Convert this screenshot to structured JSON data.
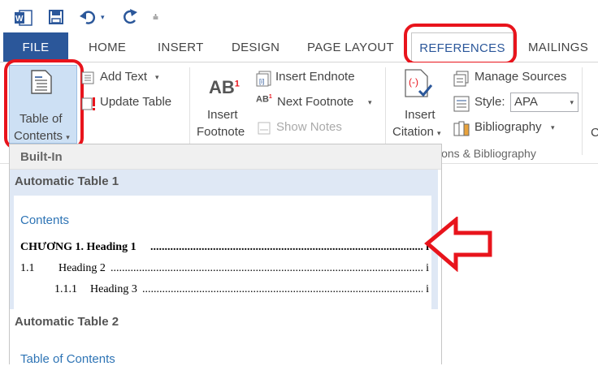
{
  "qat": {
    "word_icon": "word-logo-icon",
    "save_icon": "save-icon",
    "undo_icon": "undo-icon",
    "redo_icon": "redo-icon",
    "customize_icon": "customize-qat-icon"
  },
  "tabs": {
    "file": "FILE",
    "home": "HOME",
    "insert": "INSERT",
    "design": "DESIGN",
    "page_layout": "PAGE LAYOUT",
    "references": "REFERENCES",
    "mailings": "MAILINGS"
  },
  "ribbon": {
    "toc_line1": "Table of",
    "toc_line2": "Contents",
    "add_text": "Add Text",
    "update_table": "Update Table",
    "insert_footnote_line1": "Insert",
    "insert_footnote_line2": "Footnote",
    "footnote_icon_text": "AB",
    "footnote_icon_sup": "1",
    "insert_endnote": "Insert Endnote",
    "next_footnote": "Next Footnote",
    "next_footnote_icon_text": "AB",
    "next_footnote_icon_sup": "1",
    "show_notes": "Show Notes",
    "insert_citation_line1": "Insert",
    "insert_citation_line2": "Citation",
    "manage_sources": "Manage Sources",
    "style_label": "Style:",
    "style_value": "APA",
    "bibliography": "Bibliography",
    "group_citations": "ions & Bibliography",
    "cut_off_letter": "C"
  },
  "dropdown": {
    "section_builtin": "Built-In",
    "auto_table_1": "Automatic Table 1",
    "contents_title": "Contents",
    "toc_entries": [
      {
        "text": "CHƯƠNG 1. Heading 1",
        "page": "i"
      },
      {
        "number": "1.1",
        "text": "Heading 2",
        "page": "i"
      },
      {
        "number": "1.1.1",
        "text": "Heading 3",
        "page": "i"
      }
    ],
    "auto_table_2": "Automatic Table 2",
    "table_of_contents_title": "Table of Contents"
  },
  "colors": {
    "file_tab": "#2b579a",
    "accent_blue": "#2e74b5",
    "highlight_red": "#e8141c",
    "selected_bg": "#dfe8f5"
  }
}
